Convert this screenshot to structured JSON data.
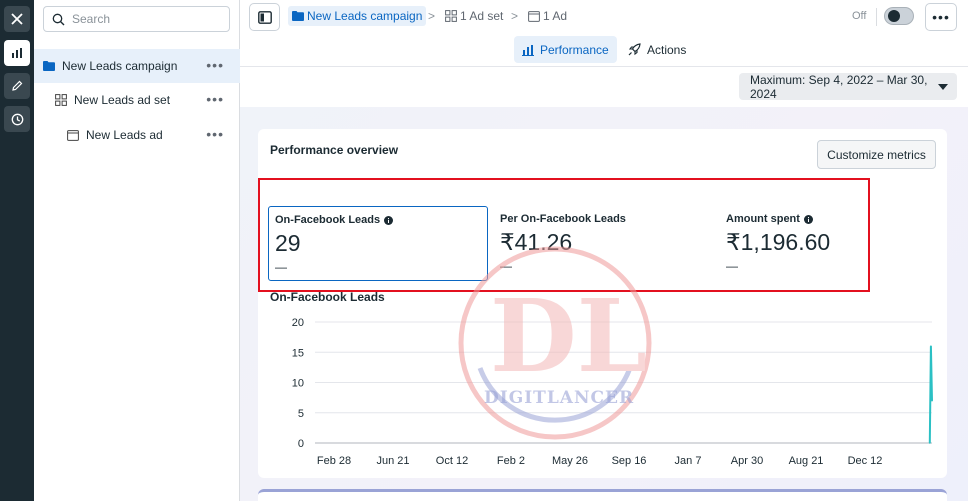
{
  "sidebar": {
    "search_placeholder": "Search",
    "items": [
      {
        "label": "New Leads campaign",
        "level": "campaign",
        "selected": true
      },
      {
        "label": "New Leads ad set",
        "level": "adset",
        "selected": false
      },
      {
        "label": "New Leads ad",
        "level": "ad",
        "selected": false
      }
    ],
    "more_label": "•••"
  },
  "topbar": {
    "breadcrumbs": [
      {
        "label": "New Leads campaign",
        "icon": "folder-icon"
      },
      {
        "label": "1 Ad set",
        "icon": "grid-icon"
      },
      {
        "label": "1 Ad",
        "icon": "ad-icon"
      }
    ],
    "separator": ">",
    "toggle_label": "Off",
    "toggle_on": false,
    "more_label": "•••"
  },
  "tabs": [
    {
      "label": "Performance",
      "icon": "bar-chart-icon",
      "active": true
    },
    {
      "label": "Actions",
      "icon": "rocket-icon",
      "active": false
    }
  ],
  "date_range": {
    "label": "Maximum: Sep 4, 2022 – Mar 30, 2024"
  },
  "overview": {
    "title": "Performance overview",
    "customize_label": "Customize metrics",
    "metrics": [
      {
        "label": "On-Facebook Leads",
        "value": "29",
        "delta": "—",
        "has_info": true,
        "selected": true
      },
      {
        "label": "Per On-Facebook Leads",
        "value": "₹41.26",
        "delta": "—",
        "has_info": false,
        "selected": false
      },
      {
        "label": "Amount spent",
        "value": "₹1,196.60",
        "delta": "—",
        "has_info": true,
        "selected": false
      }
    ]
  },
  "chart_data": {
    "type": "line",
    "title": "On-Facebook Leads",
    "xlabel": "",
    "ylabel": "",
    "ylim": [
      0,
      20
    ],
    "yticks": [
      0,
      5,
      10,
      15,
      20
    ],
    "x_tick_labels": [
      "Feb 28",
      "Jun 21",
      "Oct 12",
      "Feb 2",
      "May 26",
      "Sep 16",
      "Jan 7",
      "Apr 30",
      "Aug 21",
      "Dec 12"
    ],
    "x_range": [
      "Sep 4, 2022",
      "Mar 30, 2024"
    ],
    "grid": true,
    "series": [
      {
        "color": "#2bc0c4",
        "x": [
          "2024-03-28",
          "2024-03-29",
          "2024-03-30"
        ],
        "y": [
          0,
          16,
          7
        ]
      }
    ]
  },
  "watermark": {
    "text": "DIGITLANCER",
    "monogram": "DL"
  },
  "colors": {
    "accent": "#0a66c2",
    "highlight_box": "#e3101f",
    "chart_line": "#2bc0c4",
    "rail_bg": "#1c2b33"
  }
}
